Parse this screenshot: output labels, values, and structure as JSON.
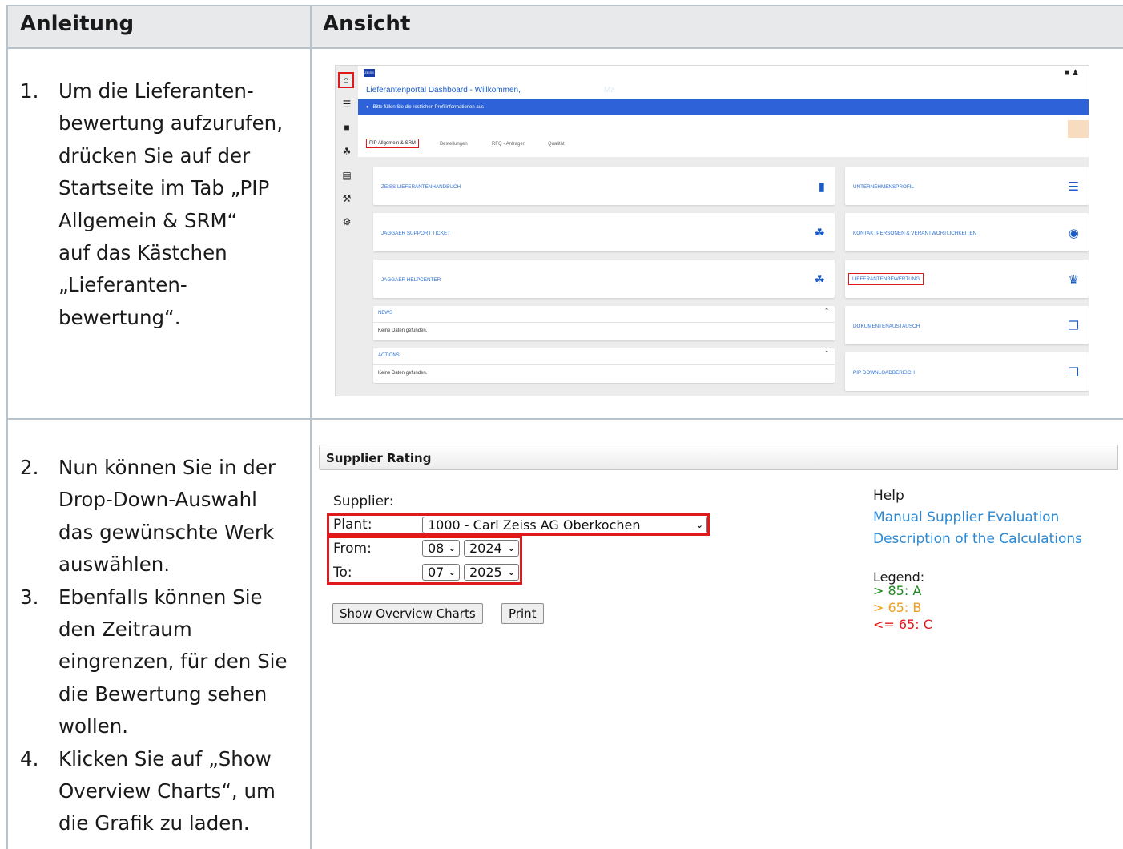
{
  "headers": {
    "left": "Anleitung",
    "right": "Ansicht"
  },
  "row1": {
    "steps": [
      {
        "num": "1.",
        "lines": [
          "Um die Lieferanten-",
          "bewertung aufzurufen,",
          "drücken Sie auf der",
          "Startseite im Tab „PIP",
          "Allgemein & SRM“",
          "auf das Kästchen",
          "„Lieferanten-",
          "bewertung“."
        ]
      }
    ]
  },
  "row2": {
    "steps": [
      {
        "num": "2.",
        "lines": [
          "Nun können Sie in der",
          "Drop-Down-Auswahl",
          "das gewünschte Werk",
          "auswählen."
        ]
      },
      {
        "num": "3.",
        "lines": [
          "Ebenfalls können Sie",
          "den Zeitraum",
          "eingrenzen, für den Sie",
          "die Bewertung sehen",
          "wollen."
        ]
      },
      {
        "num": "4.",
        "lines": [
          "Klicken Sie auf „Show",
          "Overview Charts“, um",
          "die Grafik zu laden."
        ]
      }
    ]
  },
  "portal": {
    "logo": "ZEISS",
    "title": "Lieferantenportal Dashboard - Willkommen,",
    "title_suffix": "Ma",
    "banner": "Bitte füllen Sie die restlichen Profilinformationen aus",
    "tabs": [
      "PIP Allgemein & SRM",
      "Bestellungen",
      "RFQ - Anfragen",
      "Qualität"
    ],
    "cards_left": [
      "ZEISS LIEFERANTENHANDBUCH",
      "JAGGAER SUPPORT TICKET",
      "JAGGAER HELPCENTER"
    ],
    "cards_right": [
      "UNTERNEHMENSPROFIL",
      "KONTAKTPERSONEN & VERANTWORTLICHKEITEN",
      "LIEFERANTENBEWERTUNG",
      "DOKUMENTENAUSTAUSCH",
      "PIP DOWNLOADBEREICH"
    ],
    "news": {
      "title": "NEWS",
      "body": "Keine Daten gefunden."
    },
    "actions": {
      "title": "ACTIONS",
      "body": "Keine Daten gefunden."
    },
    "icons": [
      "home-icon",
      "database-icon",
      "book-icon",
      "hand-icon",
      "bus-icon",
      "tools-icon",
      "gear-icon"
    ]
  },
  "supplier_rating": {
    "title": "Supplier Rating",
    "supplier_label": "Supplier:",
    "plant_label": "Plant:",
    "plant_value": "1000 - Carl Zeiss AG Oberkochen",
    "from_label": "From:",
    "from_month": "08",
    "from_year": "2024",
    "to_label": "To:",
    "to_month": "07",
    "to_year": "2025",
    "show_button": "Show Overview Charts",
    "print_button": "Print",
    "help_title": "Help",
    "help_links": [
      "Manual Supplier Evaluation",
      "Description of the Calculations"
    ],
    "legend_title": "Legend:",
    "legend": [
      {
        "text": "> 85: A",
        "color": "#1f8a1f"
      },
      {
        "text": "> 65: B",
        "color": "#f0a020"
      },
      {
        "text": "<= 65: C",
        "color": "#e0191b"
      }
    ]
  },
  "colors": {
    "highlight": "#e0191b",
    "link": "#2b8ad6",
    "portal_blue": "#2e62d9"
  }
}
